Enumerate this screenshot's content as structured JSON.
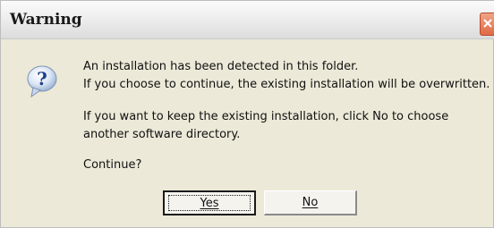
{
  "window": {
    "title": "Warning"
  },
  "icons": {
    "question": "question-icon",
    "close": "close-icon"
  },
  "message": {
    "line1": "An installation has been detected in this folder.",
    "line2": "If you choose to continue, the existing installation will be overwritten.",
    "line3": "If you want to keep the existing installation, click No to choose",
    "line4": "another software directory.",
    "prompt": "Continue?"
  },
  "buttons": {
    "yes": "Yes",
    "no": "No"
  },
  "colors": {
    "dialog_bg": "#ece9d8",
    "close_button": "#e06a45"
  }
}
